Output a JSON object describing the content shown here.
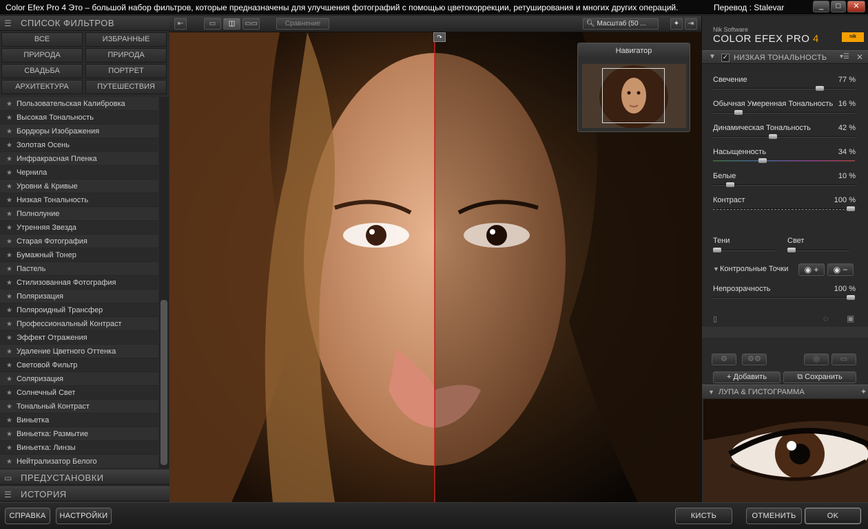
{
  "window": {
    "title": "Color Efex Pro 4  Это – большой набор фильтров, которые предназначены для улучшения фотографий с помощью цветокоррекции, ретуширования и многих других операций.",
    "translator": "Перевод : Stalevar",
    "controls": {
      "minimize": "_",
      "maximize": "□",
      "close": "✕"
    }
  },
  "left": {
    "filters_header": "СПИСОК ФИЛЬТРОВ",
    "categories": [
      "ВСЕ",
      "ИЗБРАННЫЕ",
      "ПРИРОДА",
      "ПРИРОДА",
      "СВАДЬБА",
      "ПОРТРЕТ",
      "АРХИТЕКТУРА",
      "ПУТЕШЕСТВИЯ"
    ],
    "filters": [
      "Пользовательская Калибровка",
      "Высокая Тональность",
      "Бордюры Изображения",
      "Золотая Осень",
      "Инфракрасная Пленка",
      "Чернила",
      "Уровни & Кривые",
      "Низкая Тональность",
      "Полнолуние",
      "Утренняя Звезда",
      "Старая Фотография",
      "Бумажный Тонер",
      "Пастель",
      "Стилизованная Фотография",
      "Поляризация",
      "Поляроидный Трансфер",
      "Профессиональный Контраст",
      "Эффект Отражения",
      "Удаление Цветного Оттенка",
      "Световой Фильтр",
      "Соляризация",
      "Солнечный Свет",
      "Тональный Контраст",
      "Виньетка",
      "Виньетка: Размытие",
      "Виньетка: Линзы",
      "Нейтрализатор Белого"
    ],
    "presets_header": "ПРЕДУСТАНОВКИ",
    "history_header": "ИСТОРИЯ"
  },
  "toolbar": {
    "compare_label": "Сравнение",
    "zoom_label": "Масштаб (50 ..."
  },
  "navigator": {
    "title": "Навигатор"
  },
  "right": {
    "brand_small": "Nik Software",
    "brand_main": "COLOR EFEX PRO",
    "brand_version": "4",
    "logo_text": "nik",
    "filter_title": "НИЗКАЯ ТОНАЛЬНОСТЬ",
    "sliders": [
      {
        "label": "Свечение",
        "value": 77,
        "unit": "%"
      },
      {
        "label": "Обычная Умеренная Тональность",
        "value": 16,
        "unit": "%"
      },
      {
        "label": "Динамическая Тональность",
        "value": 42,
        "unit": "%"
      },
      {
        "label": "Насыщенность",
        "value": 34,
        "unit": "%"
      },
      {
        "label": "Белые",
        "value": 10,
        "unit": "%"
      },
      {
        "label": "Контраст",
        "value": 100,
        "unit": "%"
      }
    ],
    "shadows_label": "Тени",
    "light_label": "Свет",
    "control_points_label": "Контрольные Точки",
    "opacity": {
      "label": "Непрозрачность",
      "value": 100,
      "unit": "%"
    },
    "add_label": "Добавить",
    "save_label": "Сохранить",
    "loupe_header": "ЛУПА & ГИСТОГРАММА"
  },
  "bottom": {
    "help": "СПРАВКА",
    "settings": "НАСТРОЙКИ",
    "brush": "КИСТЬ",
    "cancel": "ОТМЕНИТЬ",
    "ok": "OK"
  },
  "colors": {
    "accent": "#f5a000",
    "split_line": "#c81e1e",
    "panel_bg": "#2b2b2b"
  }
}
